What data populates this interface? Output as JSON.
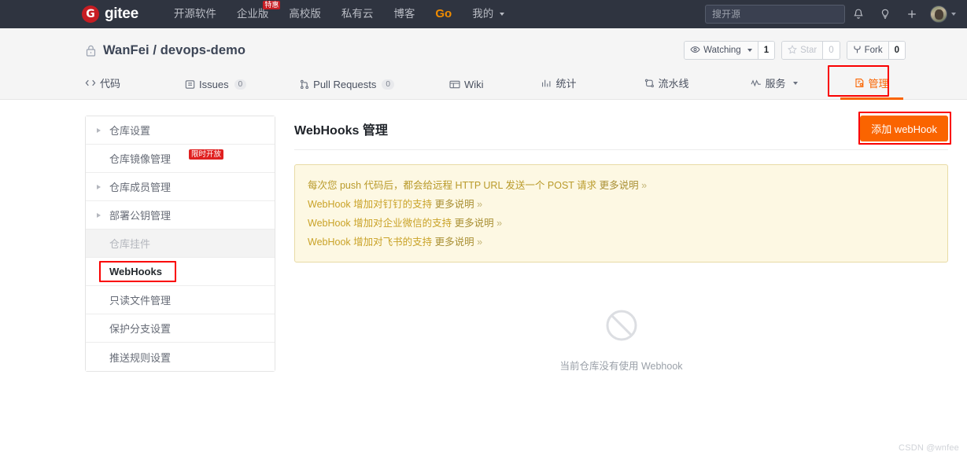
{
  "topnav": {
    "logo_text": "gitee",
    "logo_mark": "G",
    "links": [
      {
        "label": "开源软件",
        "badge": null,
        "caret": false
      },
      {
        "label": "企业版",
        "badge": "特惠",
        "caret": false
      },
      {
        "label": "高校版",
        "badge": null,
        "caret": false
      },
      {
        "label": "私有云",
        "badge": null,
        "caret": false
      },
      {
        "label": "博客",
        "badge": null,
        "caret": false
      },
      {
        "label": "Go",
        "badge": null,
        "caret": false
      },
      {
        "label": "我的",
        "badge": null,
        "caret": true
      }
    ],
    "search_placeholder": "搜开源",
    "search_value": "",
    "icons": [
      "bell-icon",
      "lightbulb-icon",
      "plus-icon",
      "avatar"
    ]
  },
  "repo": {
    "owner": "WanFei",
    "name": "devops-demo",
    "title": "WanFei / devops-demo",
    "visibility_icon": "lock-icon",
    "actions": [
      {
        "name": "watch",
        "label": "Watching",
        "count": "1",
        "caret": true,
        "disabled": false,
        "icon": "eye-icon"
      },
      {
        "name": "star",
        "label": "Star",
        "count": "0",
        "caret": false,
        "disabled": true,
        "icon": "star-icon"
      },
      {
        "name": "fork",
        "label": "Fork",
        "count": "0",
        "caret": false,
        "disabled": false,
        "icon": "fork-icon"
      }
    ]
  },
  "tabs": [
    {
      "label": "代码",
      "icon": "code-icon",
      "count": null,
      "active": false,
      "caret": false
    },
    {
      "label": "Issues",
      "icon": "issue-icon",
      "count": "0",
      "active": false,
      "caret": false
    },
    {
      "label": "Pull Requests",
      "icon": "pr-icon",
      "count": "0",
      "active": false,
      "caret": false
    },
    {
      "label": "Wiki",
      "icon": "wiki-icon",
      "count": null,
      "active": false,
      "caret": false
    },
    {
      "label": "统计",
      "icon": "chart-icon",
      "count": null,
      "active": false,
      "caret": false
    },
    {
      "label": "流水线",
      "icon": "pipeline-icon",
      "count": null,
      "active": false,
      "caret": false
    },
    {
      "label": "服务",
      "icon": "service-icon",
      "count": null,
      "active": false,
      "caret": true
    },
    {
      "label": "管理",
      "icon": "manage-icon",
      "count": null,
      "active": true,
      "caret": false
    }
  ],
  "sidebar": {
    "items": [
      {
        "label": "仓库设置",
        "arrow": true,
        "state": "normal",
        "badge": null
      },
      {
        "label": "仓库镜像管理",
        "arrow": false,
        "state": "normal",
        "badge": "限时开放"
      },
      {
        "label": "仓库成员管理",
        "arrow": true,
        "state": "normal",
        "badge": null
      },
      {
        "label": "部署公钥管理",
        "arrow": true,
        "state": "normal",
        "badge": null
      },
      {
        "label": "仓库挂件",
        "arrow": false,
        "state": "muted",
        "badge": null
      },
      {
        "label": "WebHooks",
        "arrow": false,
        "state": "active",
        "badge": null
      },
      {
        "label": "只读文件管理",
        "arrow": false,
        "state": "normal",
        "badge": null
      },
      {
        "label": "保护分支设置",
        "arrow": false,
        "state": "normal",
        "badge": null
      },
      {
        "label": "推送规则设置",
        "arrow": false,
        "state": "normal",
        "badge": null
      }
    ]
  },
  "content": {
    "title": "WebHooks 管理",
    "add_button": "添加 webHook",
    "alert_lines": [
      {
        "text": "每次您 push 代码后，都会给远程 HTTP URL 发送一个 POST 请求 ",
        "link": "更多说明",
        "chev": " »"
      },
      {
        "text": "WebHook 增加对钉钉的支持 ",
        "link": "更多说明",
        "chev": " »"
      },
      {
        "text": "WebHook 增加对企业微信的支持 ",
        "link": "更多说明",
        "chev": " »"
      },
      {
        "text": "WebHook 增加对飞书的支持 ",
        "link": "更多说明",
        "chev": " »"
      }
    ],
    "empty_icon": "ban-icon",
    "empty_text": "当前仓库没有使用 Webhook"
  },
  "watermark": "CSDN @wnfee",
  "colors": {
    "nav_bg": "#2f3440",
    "brand_red": "#c71d23",
    "accent_orange": "#fa6400",
    "annotation_red": "#fa0000",
    "alert_bg": "#fdf8e3",
    "alert_border": "#e8dba5",
    "alert_text": "#c9a227"
  }
}
